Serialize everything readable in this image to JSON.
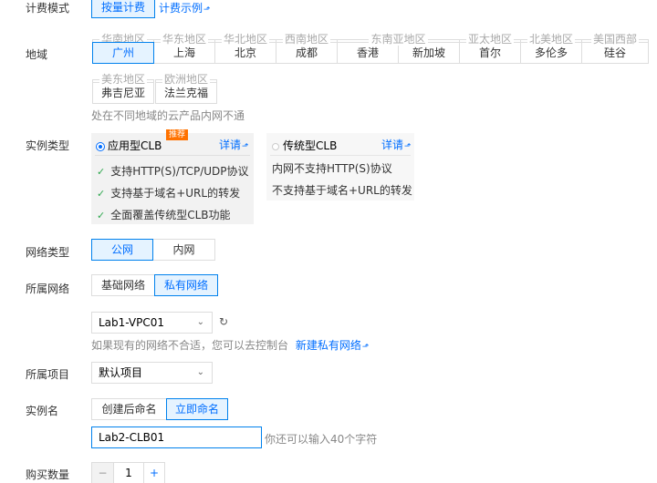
{
  "billing": {
    "label": "计费模式",
    "option": "按量计费",
    "link": "计费示例"
  },
  "region": {
    "label": "地域",
    "groups": [
      {
        "name": "华南地区",
        "cities": [
          {
            "name": "广州",
            "selected": true
          }
        ]
      },
      {
        "name": "华东地区",
        "cities": [
          {
            "name": "上海"
          }
        ]
      },
      {
        "name": "华北地区",
        "cities": [
          {
            "name": "北京"
          }
        ]
      },
      {
        "name": "西南地区",
        "cities": [
          {
            "name": "成都"
          }
        ]
      },
      {
        "name": "东南亚地区",
        "cities": [
          {
            "name": "香港"
          },
          {
            "name": "新加坡"
          }
        ]
      },
      {
        "name": "亚太地区",
        "cities": [
          {
            "name": "首尔"
          }
        ]
      },
      {
        "name": "北美地区",
        "cities": [
          {
            "name": "多伦多"
          }
        ]
      },
      {
        "name": "美国西部",
        "cities": [
          {
            "name": "硅谷"
          }
        ]
      },
      {
        "name": "美东地区",
        "cities": [
          {
            "name": "弗吉尼亚"
          }
        ]
      },
      {
        "name": "欧洲地区",
        "cities": [
          {
            "name": "法兰克福"
          }
        ]
      }
    ],
    "hint": "处在不同地域的云产品内网不通"
  },
  "instance_type": {
    "label": "实例类型",
    "app_clb": {
      "title": "应用型CLB",
      "badge": "推荐",
      "detail": "详请",
      "features": [
        "支持HTTP(S)/TCP/UDP协议",
        "支持基于域名+URL的转发",
        "全面覆盖传统型CLB功能"
      ]
    },
    "classic_clb": {
      "title": "传统型CLB",
      "detail": "详请",
      "notes": [
        "内网不支持HTTP(S)协议",
        "不支持基于域名+URL的转发"
      ]
    }
  },
  "network_type": {
    "label": "网络类型",
    "options": [
      "公网",
      "内网"
    ]
  },
  "network": {
    "label": "所属网络",
    "options": [
      "基础网络",
      "私有网络"
    ],
    "vpc_value": "Lab1-VPC01",
    "hint": "如果现有的网络不合适，您可以去控制台",
    "hint_link": "新建私有网络"
  },
  "project": {
    "label": "所属项目",
    "value": "默认项目"
  },
  "instance_name": {
    "label": "实例名",
    "options": [
      "创建后命名",
      "立即命名"
    ],
    "value": "Lab2-CLB01",
    "hint": "你还可以输入40个字符"
  },
  "quantity": {
    "label": "购买数量",
    "value": "1",
    "minus": "−",
    "plus": "+"
  },
  "colors": {
    "accent": "#006eff",
    "selected_bg": "#e5f3ff",
    "badge": "#ff7200",
    "check": "#2fa84f"
  }
}
